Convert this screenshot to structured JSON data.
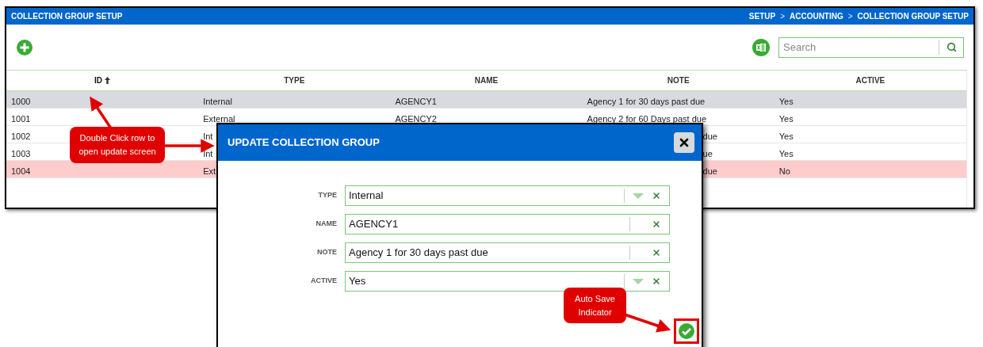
{
  "window": {
    "title": "COLLECTION GROUP SETUP"
  },
  "breadcrumb": [
    {
      "kind": "crumb",
      "text": "SETUP"
    },
    {
      "kind": "separator",
      "text": ">"
    },
    {
      "kind": "crumb",
      "text": "ACCOUNTING"
    },
    {
      "kind": "separator",
      "text": ">"
    },
    {
      "kind": "crumb",
      "text": "COLLECTION GROUP SETUP"
    }
  ],
  "search": {
    "placeholder": "Search"
  },
  "table": {
    "columns": [
      {
        "label": "ID",
        "sorted": true
      },
      {
        "label": "TYPE",
        "sorted": false
      },
      {
        "label": "NAME",
        "sorted": false
      },
      {
        "label": "NOTE",
        "sorted": false
      },
      {
        "label": "ACTIVE",
        "sorted": false
      }
    ],
    "rows": [
      {
        "selected": true,
        "inactive": false,
        "covered": false,
        "cells": [
          "1000",
          "Internal",
          "AGENCY1",
          "Agency 1 for 30 days past due",
          "Yes"
        ]
      },
      {
        "selected": false,
        "inactive": false,
        "covered": false,
        "cells": [
          "1001",
          "External",
          "AGENCY2",
          "Agency 2 for 60 Days past due",
          "Yes"
        ]
      },
      {
        "selected": false,
        "inactive": false,
        "covered": true,
        "cells": [
          "1002",
          "Int",
          "",
          "due",
          "Yes"
        ]
      },
      {
        "selected": false,
        "inactive": false,
        "covered": true,
        "cells": [
          "1003",
          "Int",
          "",
          "ue",
          "Yes"
        ]
      },
      {
        "selected": false,
        "inactive": true,
        "covered": true,
        "cells": [
          "1004",
          "Ext",
          "",
          "due",
          "No"
        ]
      }
    ]
  },
  "dialog": {
    "title": "UPDATE COLLECTION GROUP",
    "fields": [
      {
        "kind": "select",
        "label": "TYPE",
        "value": "Internal"
      },
      {
        "kind": "text",
        "label": "NAME",
        "value": "AGENCY1"
      },
      {
        "kind": "text",
        "label": "NOTE",
        "value": "Agency 1 for 30 days past due"
      },
      {
        "kind": "select",
        "label": "ACTIVE",
        "value": "Yes"
      }
    ],
    "saved": true
  },
  "annotations": [
    {
      "text": "Double Click row to open update screen"
    },
    {
      "text": "Auto Save Indicator"
    }
  ]
}
